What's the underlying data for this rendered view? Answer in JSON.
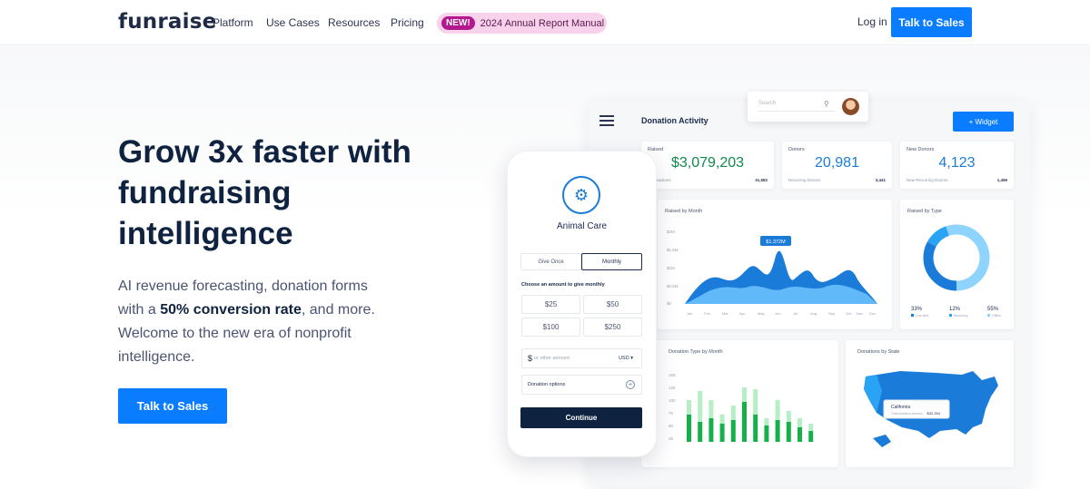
{
  "nav": {
    "logo": "funraise",
    "links": [
      "Platform",
      "Use Cases",
      "Resources",
      "Pricing"
    ],
    "announcement_badge": "NEW!",
    "announcement_text": "2024 Annual Report Manual",
    "login": "Log in",
    "cta": "Talk to Sales"
  },
  "hero": {
    "headline": "Grow 3x faster with fundraising intelligence",
    "sub_before": "AI revenue forecasting, donation forms with a ",
    "sub_bold": "50% conversion rate",
    "sub_after": ", and more. Welcome to the new era of nonprofit intelligence.",
    "cta": "Talk to Sales"
  },
  "dashboard": {
    "title": "Donation Activity",
    "search_placeholder": "Search",
    "widget_button": "+ Widget",
    "kpis": [
      {
        "label": "Raised",
        "value": "$3,079,203",
        "foot_label": "Transactions",
        "foot_value": "31,582",
        "color": "#0f8a4b"
      },
      {
        "label": "Donors",
        "value": "20,981",
        "foot_label": "Recurring Donors",
        "foot_value": "3,441",
        "color": "#1b7bd8"
      },
      {
        "label": "New Donors",
        "value": "4,123",
        "foot_label": "New Recurring Donors",
        "foot_value": "1,456",
        "color": "#1b7bd8"
      }
    ],
    "raised_by_month": {
      "title": "Raised by Month",
      "tooltip": "$1.372M",
      "yticks": [
        "$2M",
        "$1.5M",
        "$1M",
        "$0.5M",
        "$0"
      ],
      "months": [
        "Jan",
        "Feb",
        "Mar",
        "Apr",
        "May",
        "Jun",
        "Jul",
        "Aug",
        "Sep",
        "Oct",
        "Nov",
        "Dec"
      ]
    },
    "raised_by_type": {
      "title": "Raised by Type",
      "items": [
        {
          "pct": "33%",
          "label": "One-time",
          "color": "#1b7bd8"
        },
        {
          "pct": "12%",
          "label": "Recurring",
          "color": "#2aa3f4"
        },
        {
          "pct": "55%",
          "label": "Offline",
          "color": "#8fd3ff"
        }
      ]
    },
    "donation_type_by_month": {
      "title": "Donation Type by Month",
      "yticks": [
        "150",
        "125",
        "100",
        "75",
        "50",
        "25",
        "0"
      ]
    },
    "donations_by_state": {
      "title": "Donations by State",
      "tooltip_state": "California",
      "tooltip_label": "Total donation amount",
      "tooltip_value": "$32,394"
    }
  },
  "phone": {
    "org_name": "Animal Care",
    "tab_once": "Give Once",
    "tab_monthly": "Monthly",
    "amount_label": "Choose an amount to give monthly",
    "amounts": [
      "$25",
      "$50",
      "$100",
      "$250"
    ],
    "other_placeholder": "or other amount",
    "currency": "USD",
    "donation_options": "Donation options",
    "continue": "Continue"
  }
}
